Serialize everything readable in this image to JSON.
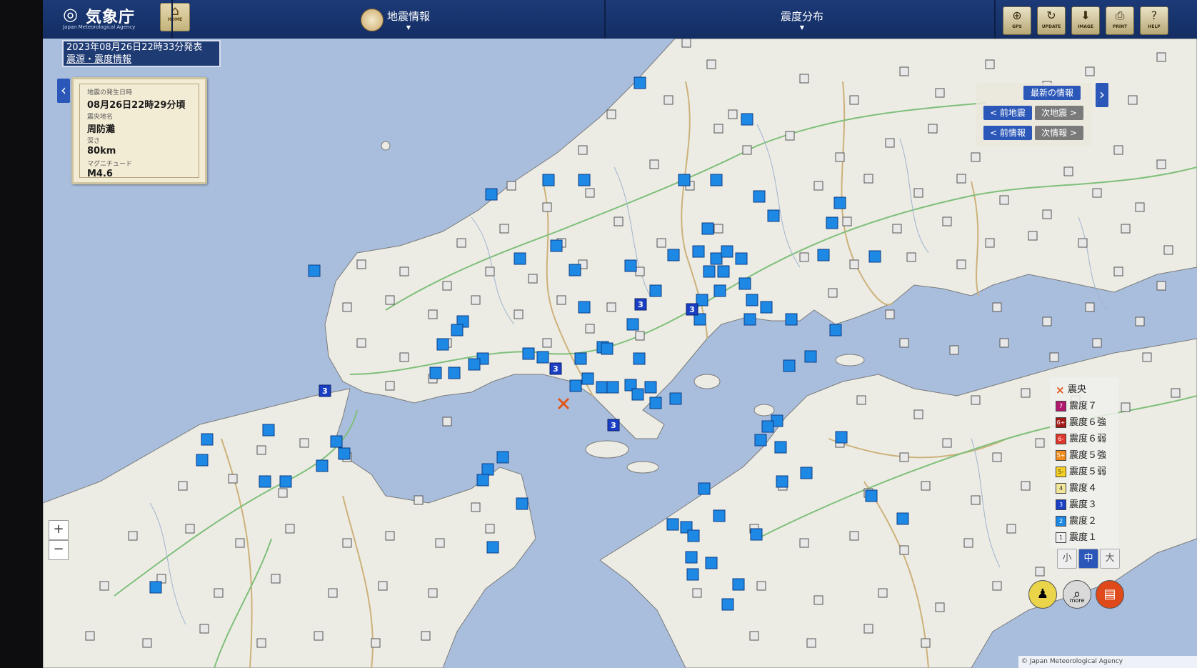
{
  "header": {
    "agency_name": "気象庁",
    "agency_name_en": "Japan Meteorological Agency",
    "home_label": "HOME",
    "tab_quake_info": "地震情報",
    "tab_intensity_dist": "震度分布",
    "tools": [
      {
        "label": "GPS",
        "icon": "gps-icon"
      },
      {
        "label": "UPDATE",
        "icon": "update-icon"
      },
      {
        "label": "IMAGE",
        "icon": "download-icon"
      },
      {
        "label": "PRINT",
        "icon": "print-icon"
      },
      {
        "label": "HELP",
        "icon": "help-icon"
      }
    ]
  },
  "announcement": {
    "issued": "2023年08月26日22時33分発表",
    "type": "震源・震度情報"
  },
  "quake": {
    "time_label": "地震の発生日時",
    "time_value": "08月26日22時29分頃",
    "place_label": "震央地名",
    "place_value": "周防灘",
    "depth_label": "深さ",
    "depth_value": "80km",
    "magnitude_label": "マグニチュード",
    "magnitude_value": "M4.6"
  },
  "nav": {
    "latest": "最新の情報",
    "prev_quake": "< 前地震",
    "next_quake": "次地震 >",
    "prev_info": "< 前情報",
    "next_info": "次情報 >"
  },
  "legend": {
    "epicenter": "震央",
    "items": [
      {
        "code": "7",
        "label": "震度７",
        "color": "#b0186e"
      },
      {
        "code": "6+",
        "label": "震度６強",
        "color": "#a51717"
      },
      {
        "code": "6-",
        "label": "震度６弱",
        "color": "#e0352b"
      },
      {
        "code": "5+",
        "label": "震度５強",
        "color": "#f08b1c"
      },
      {
        "code": "5-",
        "label": "震度５弱",
        "color": "#f5d023"
      },
      {
        "code": "4",
        "label": "震度４",
        "color": "#f2e69a"
      },
      {
        "code": "3",
        "label": "震度３",
        "color": "#1a3fc4"
      },
      {
        "code": "2",
        "label": "震度２",
        "color": "#1e88e5"
      },
      {
        "code": "1",
        "label": "震度１",
        "color": "#f0f0f0"
      }
    ]
  },
  "size_buttons": [
    "小",
    "中",
    "大"
  ],
  "zoom": {
    "in": "+",
    "out": "−"
  },
  "bottom_buttons": [
    {
      "label": "",
      "icon": "person-icon"
    },
    {
      "label": "more",
      "icon": "magnifier-icon"
    },
    {
      "label": "",
      "icon": "book-icon"
    }
  ],
  "copyright": "© Japan Meteorological Agency",
  "colors": {
    "header": "#1c3a78",
    "sea": "#a9bedd",
    "land": "#ecece4",
    "intensity1": "#f0f0f0",
    "intensity2": "#1e88e5",
    "intensity3": "#1a3fc4",
    "epicenter": "#e0571a"
  }
}
